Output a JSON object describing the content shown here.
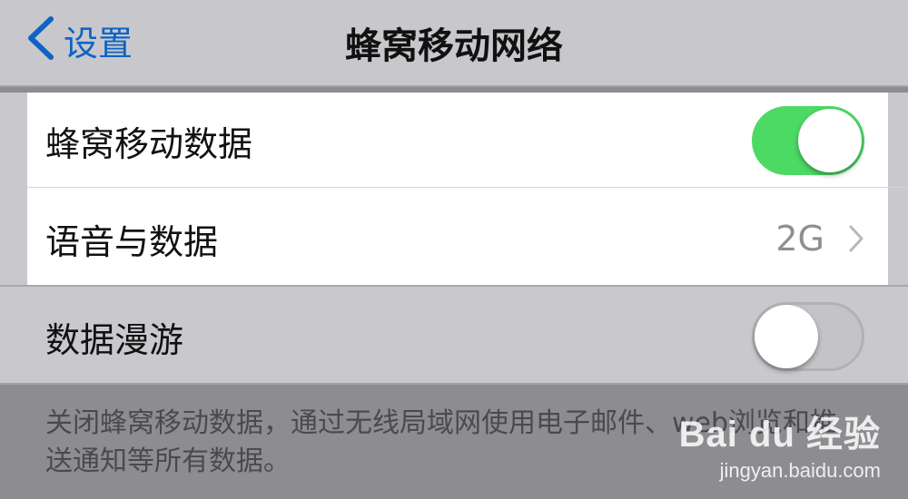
{
  "navbar": {
    "back_label": "设置",
    "title": "蜂窝移动网络"
  },
  "settings": {
    "cellular_data": {
      "label": "蜂窝移动数据",
      "enabled": true
    },
    "voice_data": {
      "label": "语音与数据",
      "value": "2G"
    },
    "data_roaming": {
      "label": "数据漫游",
      "enabled": false
    }
  },
  "footer": {
    "text": "关闭蜂窝移动数据，通过无线局域网使用电子邮件、web浏览和推送通知等所有数据。"
  },
  "watermark": {
    "logo": "Bai du 经验",
    "url": "jingyan.baidu.com"
  },
  "colors": {
    "accent": "#0e63c4",
    "toggle_on": "#4cd964",
    "toggle_off": "#c4c4c8"
  },
  "icons": {
    "back": "chevron-left-icon",
    "disclosure": "chevron-right-icon"
  }
}
